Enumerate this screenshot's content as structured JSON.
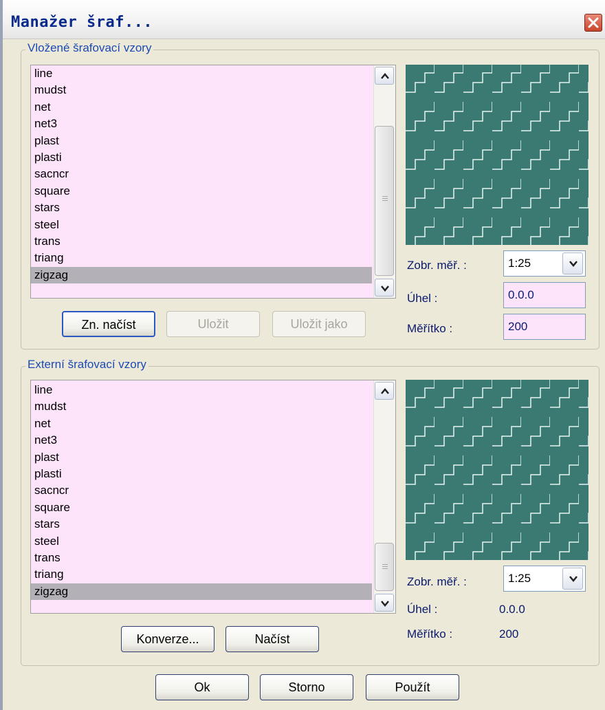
{
  "window": {
    "title": "Manažer šraf..."
  },
  "embedded": {
    "legend": "Vložené šrafovací vzory",
    "items": [
      "line",
      "mudst",
      "net",
      "net3",
      "plast",
      "plasti",
      "sacncr",
      "square",
      "stars",
      "steel",
      "trans",
      "triang",
      "zigzag"
    ],
    "selected_index": 12,
    "scale_label": "Zobr. měř. :",
    "scale_value": "1:25",
    "angle_label": "Úhel :",
    "angle_value": "0.0.0",
    "factor_label": "Měřítko :",
    "factor_value": "200",
    "buttons": {
      "load": "Zn. načíst",
      "save": "Uložit",
      "save_as": "Uložit jako"
    }
  },
  "external": {
    "legend": "Externí šrafovací vzory",
    "items": [
      "line",
      "mudst",
      "net",
      "net3",
      "plast",
      "plasti",
      "sacncr",
      "square",
      "stars",
      "steel",
      "trans",
      "triang",
      "zigzag"
    ],
    "selected_index": 12,
    "scale_label": "Zobr. měř. :",
    "scale_value": "1:25",
    "angle_label": "Úhel :",
    "angle_value": "0.0.0",
    "factor_label": "Měřítko :",
    "factor_value": "200",
    "buttons": {
      "convert": "Konverze...",
      "load": "Načíst"
    }
  },
  "footer": {
    "ok": "Ok",
    "cancel": "Storno",
    "apply": "Použít"
  },
  "colors": {
    "list_bg": "#fde4fb",
    "preview_bg": "#3a7a72",
    "selection": "#b3b0b8",
    "title_text": "#0a2a8c"
  },
  "icons": [
    "close-icon",
    "scroll-up-icon",
    "scroll-down-icon",
    "dropdown-arrow-icon"
  ]
}
